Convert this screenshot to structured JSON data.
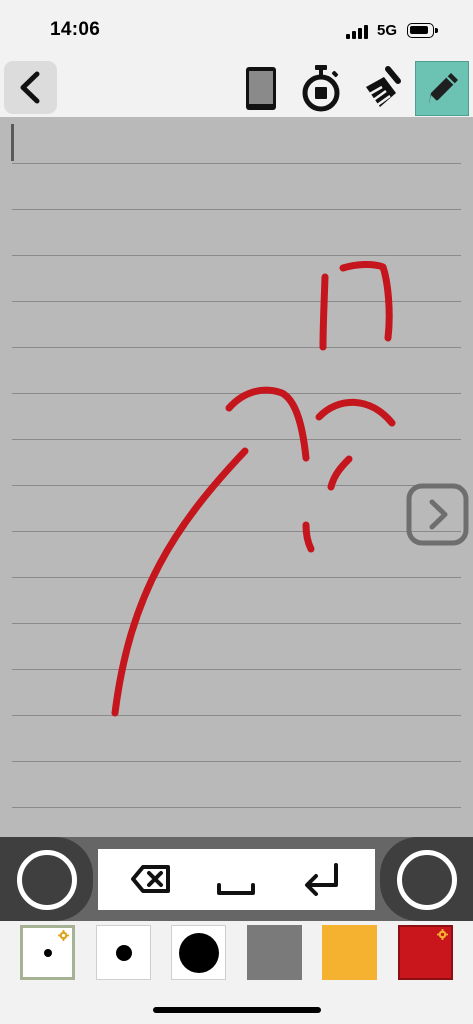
{
  "status_bar": {
    "time": "14:06",
    "network": "5G",
    "icons": [
      "cellular-signal-icon",
      "battery-icon"
    ]
  },
  "toolbar": {
    "back_icon": "chevron-left-icon",
    "tools": [
      {
        "name": "device-preview",
        "icon": "phone-icon"
      },
      {
        "name": "timer",
        "icon": "stopwatch-icon"
      },
      {
        "name": "clear",
        "icon": "broom-icon"
      },
      {
        "name": "pen",
        "icon": "pencil-icon",
        "active": true,
        "color": "#6cc2b3"
      }
    ]
  },
  "canvas": {
    "background": "#b9b9b9",
    "rule_color": "#8a8a8a",
    "ink_color": "#c4161c",
    "next_icon": "chevron-right-icon"
  },
  "input_bar": {
    "left_mode_icon": "circle-icon",
    "right_mode_icon": "circle-icon",
    "keys": [
      {
        "name": "backspace",
        "icon": "backspace-icon"
      },
      {
        "name": "space",
        "icon": "space-icon"
      },
      {
        "name": "return",
        "icon": "return-icon"
      }
    ]
  },
  "palette": {
    "pen_sizes": [
      "small",
      "medium",
      "large"
    ],
    "selected_pen_size": "small",
    "colors": [
      "#7a7a7a",
      "#f5b130",
      "#c9161c"
    ],
    "selected_color": "#c9161c",
    "settings_icon": "gear-icon"
  }
}
